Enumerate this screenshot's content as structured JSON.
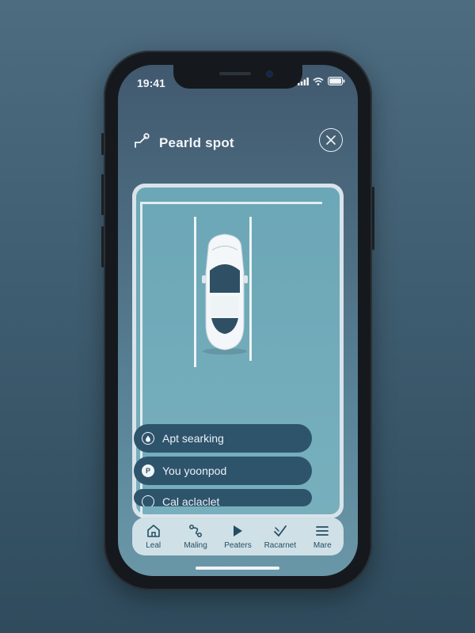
{
  "status_bar": {
    "time": "19:41",
    "icons": [
      "cellular-icon",
      "wifi-icon",
      "battery-icon"
    ]
  },
  "header": {
    "title": "Pearld spot",
    "back_icon": "key-icon",
    "close_icon": "close-icon"
  },
  "colors": {
    "accent": "#2e546c",
    "marker": "#f0c419",
    "map": "#6ca7b7",
    "tabbar": "#cfe0e7"
  },
  "list": [
    {
      "label": "Apt searking",
      "icon": "drop-icon"
    },
    {
      "label": "You yoonpod",
      "icon": "parking-icon"
    },
    {
      "label": "Cal aclaclet",
      "icon": "box-icon"
    }
  ],
  "tabs": [
    {
      "label": "Leal",
      "icon": "home-icon"
    },
    {
      "label": "Maling",
      "icon": "route-icon"
    },
    {
      "label": "Peaters",
      "icon": "play-icon"
    },
    {
      "label": "Racarnet",
      "icon": "check-icon"
    },
    {
      "label": "Mare",
      "icon": "menu-icon"
    }
  ]
}
